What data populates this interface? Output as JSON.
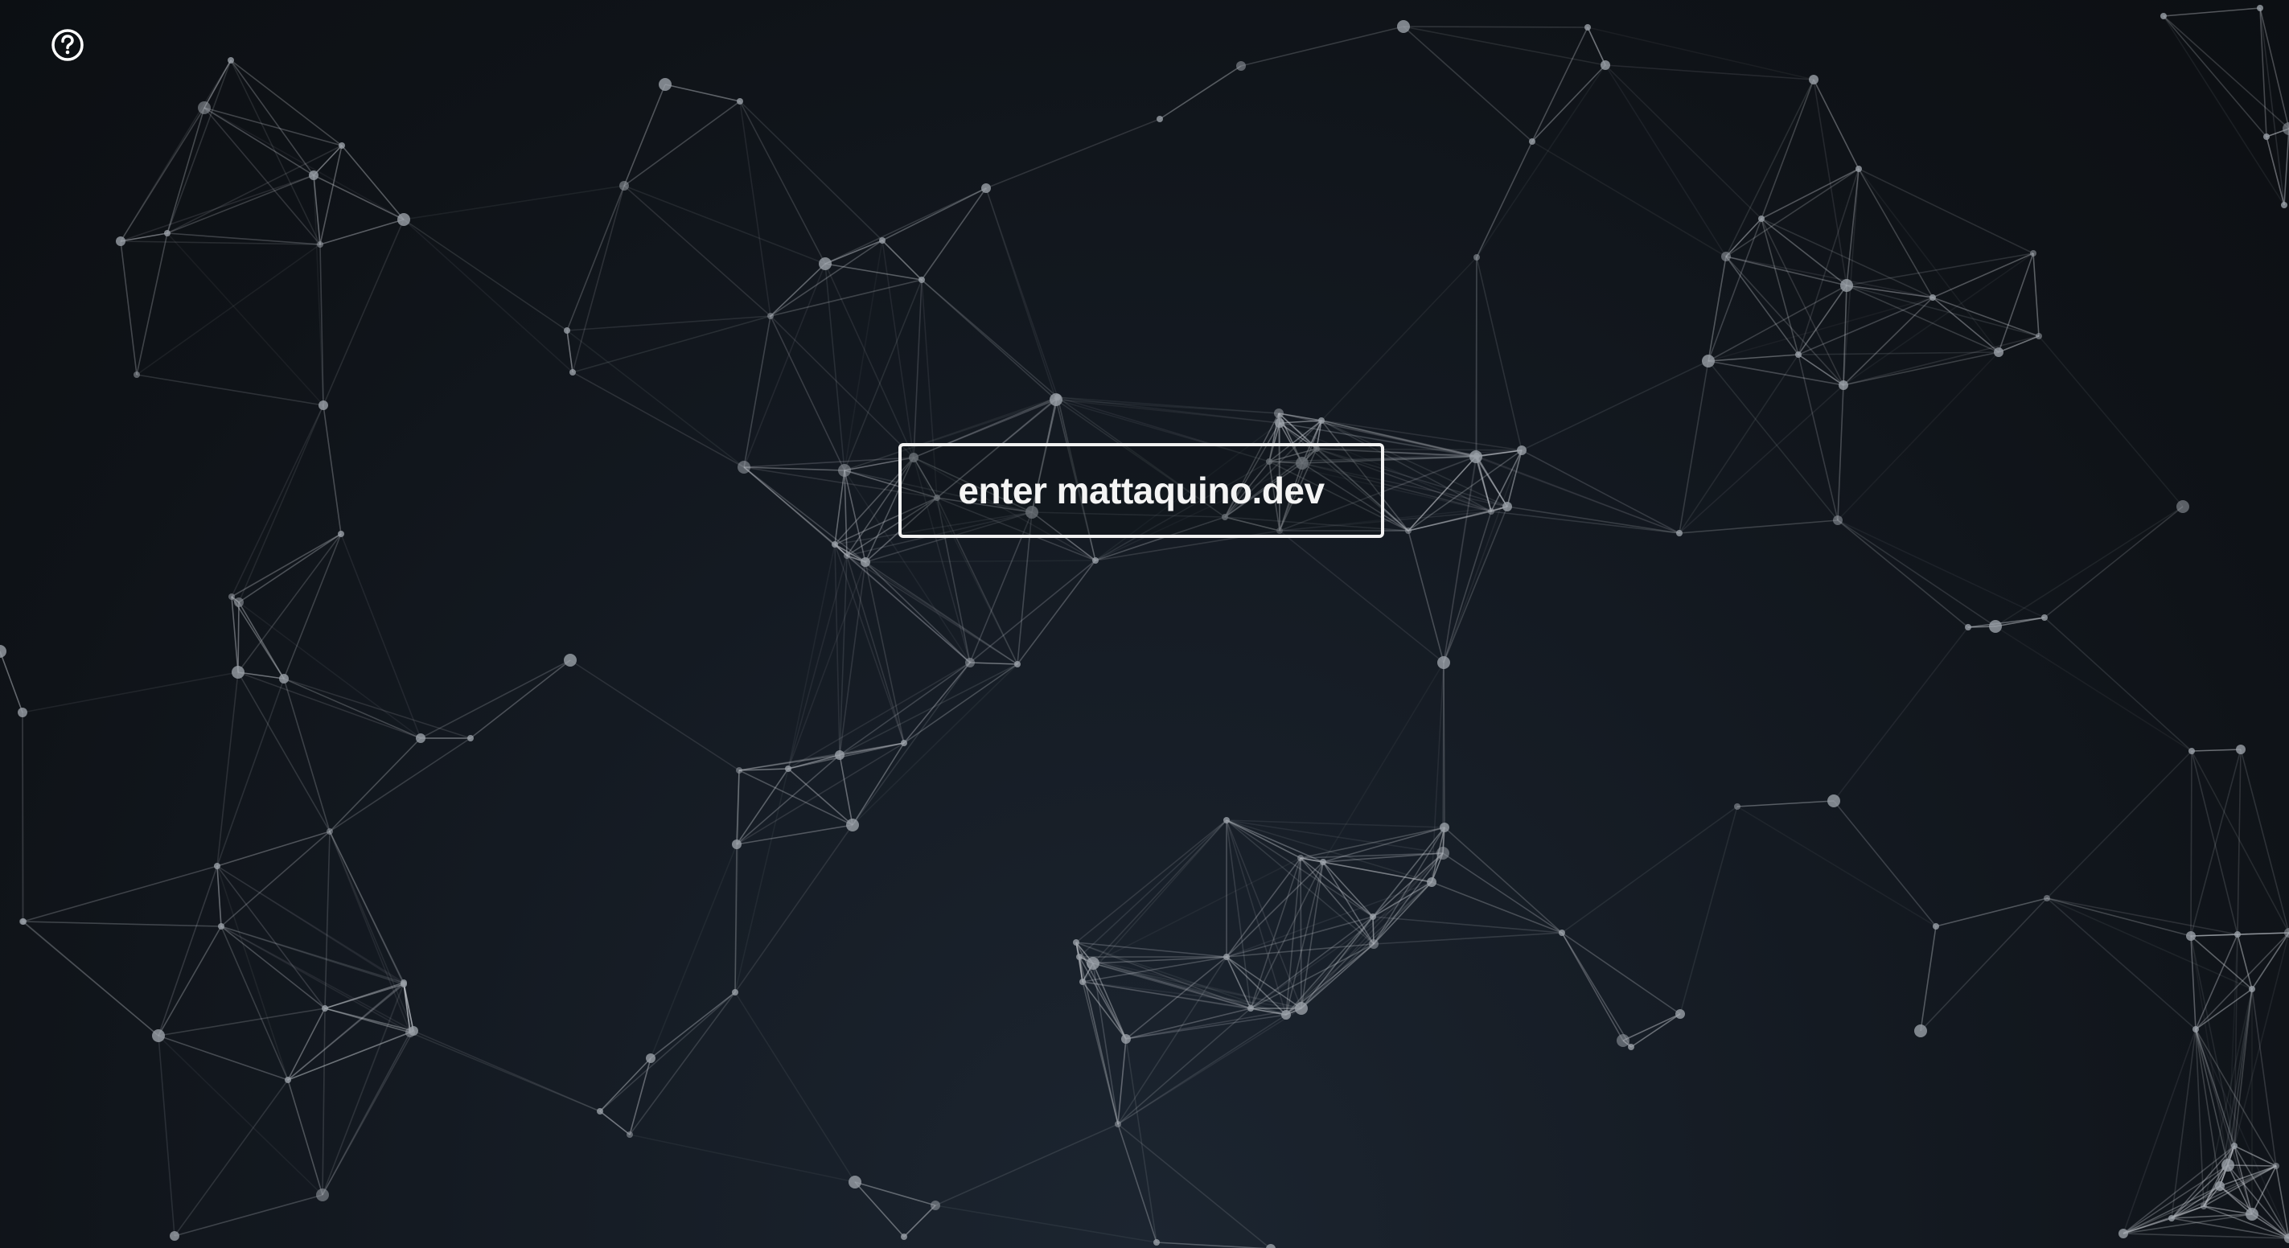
{
  "page": {
    "background_color": "#12171e",
    "line_color": "#c8ccd2",
    "node_color": "#9aa0a8"
  },
  "help": {
    "icon": "question-circle-icon"
  },
  "enter": {
    "label": "enter mattaquino.dev",
    "border_color": "#f2f2f2"
  }
}
